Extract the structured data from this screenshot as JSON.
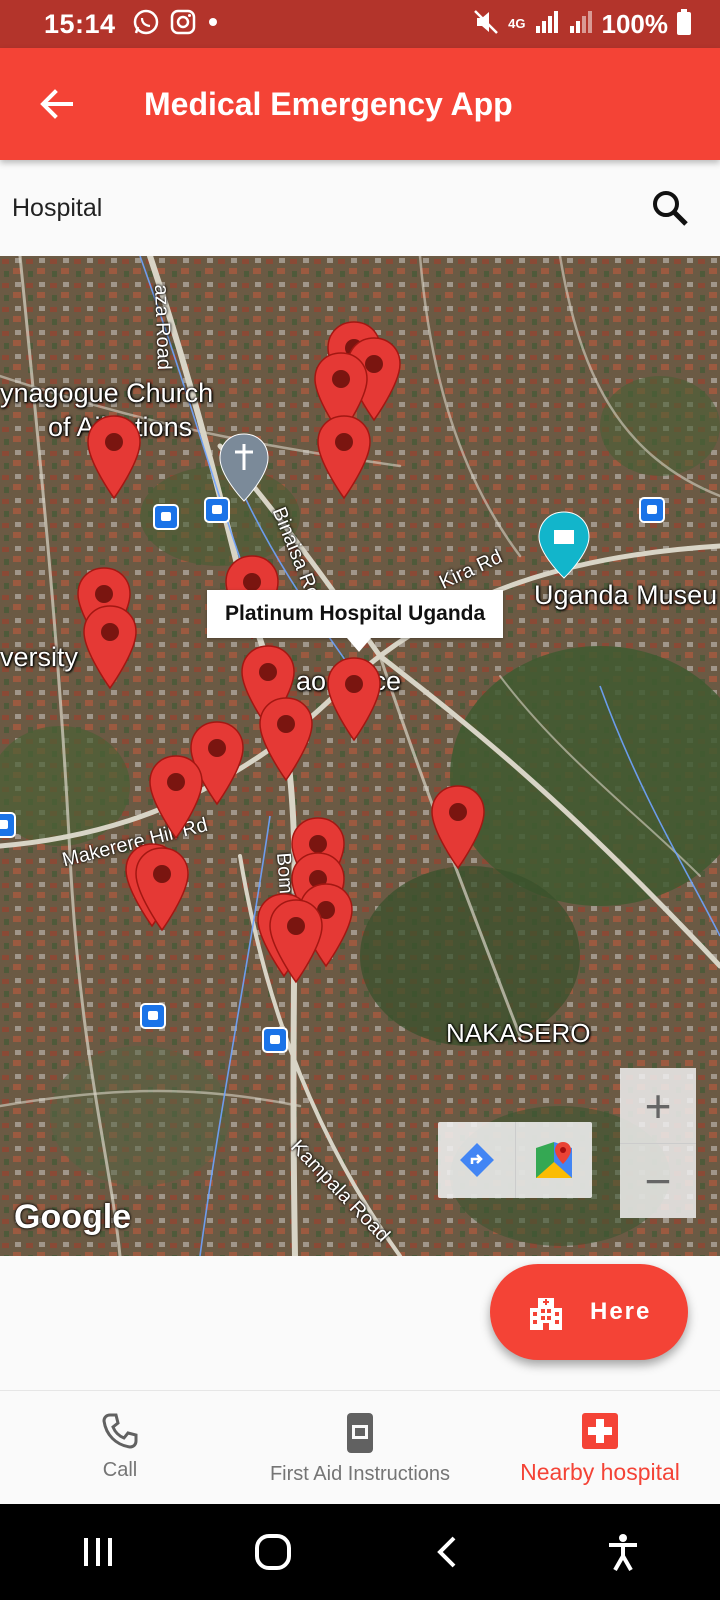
{
  "status_bar": {
    "time": "15:14",
    "battery": "100%",
    "network": "4G"
  },
  "app_bar": {
    "title": "Medical Emergency App"
  },
  "search": {
    "value": "Hospital"
  },
  "map": {
    "labels": {
      "synagogue": "ynagogue Church",
      "synagogue2": "of Ajj lations",
      "museum": "Uganda Museu",
      "university": "versity",
      "place": "ao Place",
      "nakasero": "NAKASERO"
    },
    "roads": {
      "plaza": "aza Road",
      "binaisa": "Binaisa Road",
      "kira": "Kira Rd",
      "makerere": "Makerere Hill Rd",
      "bombo": "Bombo Rd",
      "kampala": "Kampala Road"
    },
    "callout": "Platinum Hospital Uganda",
    "google": "Google",
    "zoom_in": "+",
    "zoom_out": "−"
  },
  "fab": {
    "label": "Here"
  },
  "nav": {
    "call": "Call",
    "first_aid": "First Aid Instructions",
    "nearby": "Nearby hospital"
  },
  "colors": {
    "primary": "#f44336",
    "status": "#b3342b",
    "marker": "#e53935"
  }
}
